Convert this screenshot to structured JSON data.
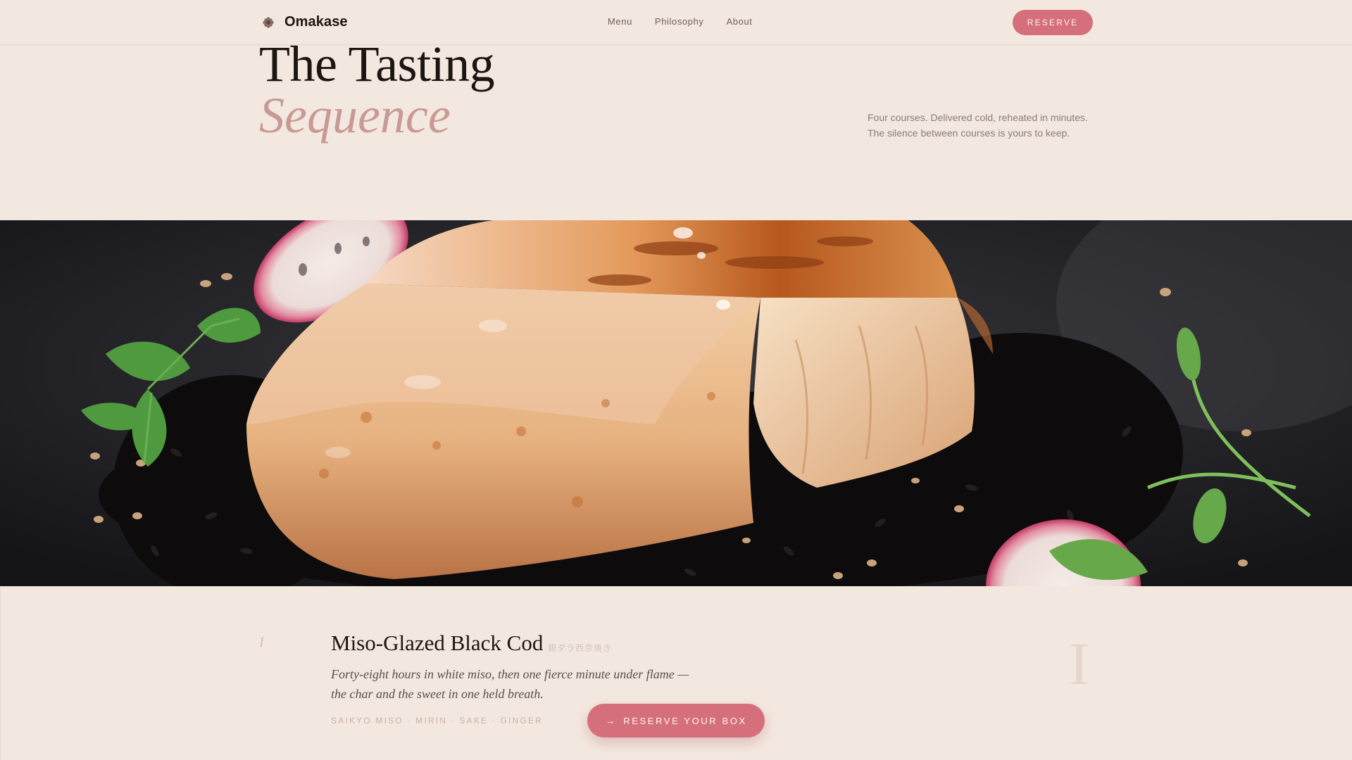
{
  "nav": {
    "brand": "Omakase",
    "brand_icon": "flower-logo-icon",
    "links": [
      "Menu",
      "Philosophy",
      "About"
    ],
    "cta": "RESERVE"
  },
  "hero": {
    "title": "The Tasting",
    "subtitle": "Sequence",
    "description_lines": [
      "Four courses. Delivered cold, reheated in minutes.",
      "The silence between courses is yours to keep."
    ]
  },
  "course": {
    "number": "I",
    "title": "Miso-Glazed Black Cod",
    "japanese": "銀ダラ西京焼き",
    "description_lines": [
      "Forty-eight hours in white miso, then one fierce minute under flame —",
      "the char and the sweet in one held breath."
    ],
    "tags": "SAIKYO MISO · MIRIN · SAKE · GINGER",
    "roman": "I",
    "cta": "RESERVE YOUR BOX",
    "cta_icon": "arrow-right-icon"
  },
  "colors": {
    "background": "#f3e8df",
    "accent": "#d56f7b",
    "subtitle": "#c99a95",
    "text": "#1c1512"
  }
}
